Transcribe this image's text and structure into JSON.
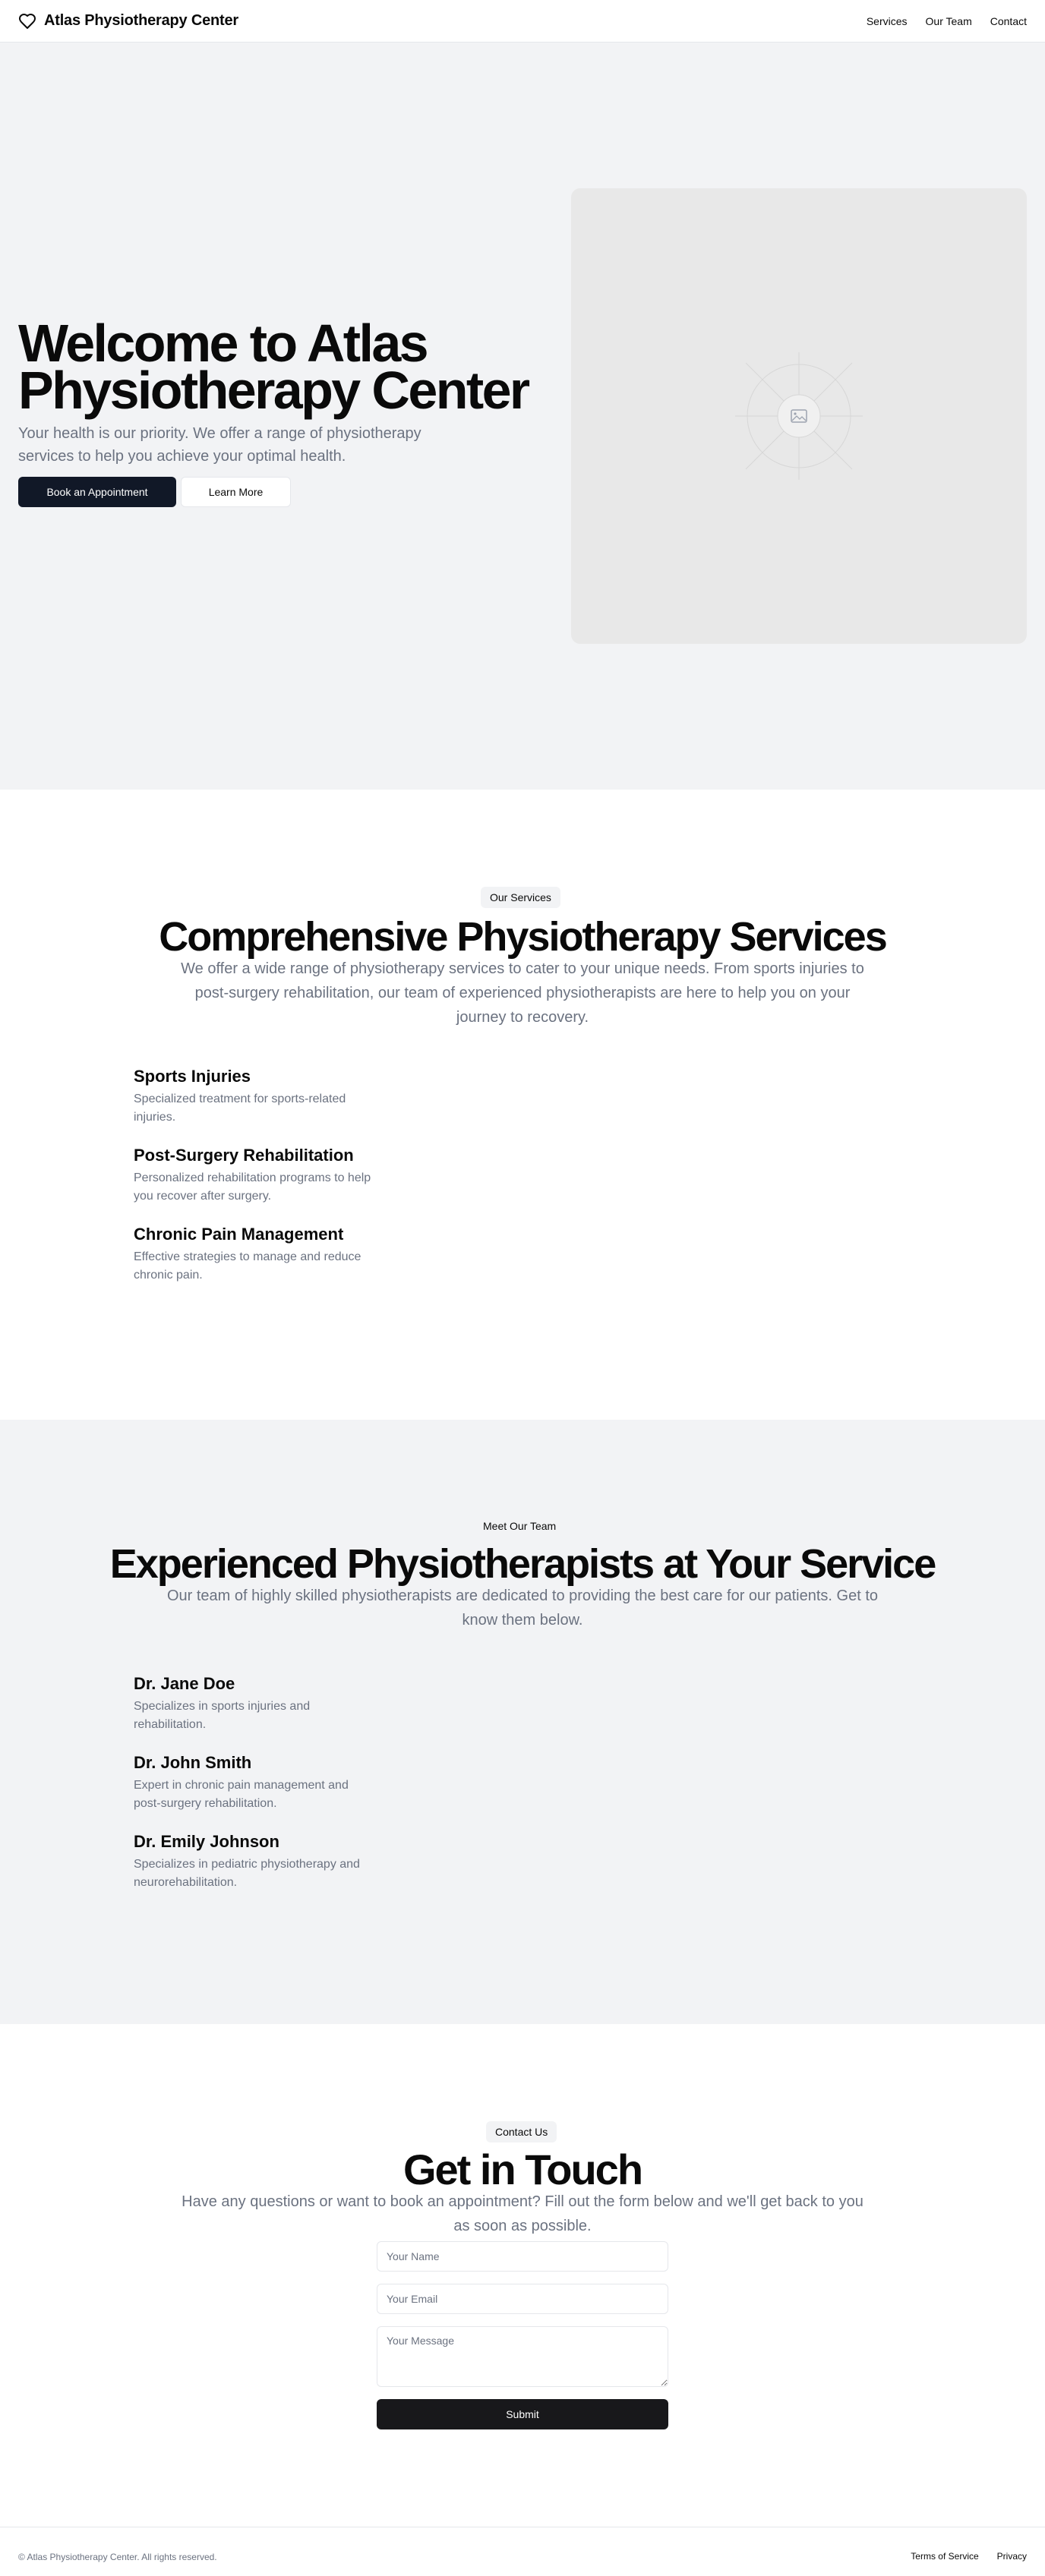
{
  "header": {
    "brand_name": "Atlas Physiotherapy Center",
    "logo_icon": "heart-icon",
    "nav": [
      {
        "label": "Services"
      },
      {
        "label": "Our Team"
      },
      {
        "label": "Contact"
      }
    ]
  },
  "hero": {
    "title_line1": "Welcome to Atlas",
    "title_line2": "Physiotherapy Center",
    "text": "Your health is our priority. We offer a range of physiotherapy services to help you achieve your optimal health.",
    "primary_button": "Book an Appointment",
    "secondary_button": "Learn More",
    "image_icon": "image-placeholder-icon"
  },
  "services": {
    "badge": "Our Services",
    "title": "Comprehensive Physiotherapy Services",
    "text": "We offer a wide range of physiotherapy services to cater to your unique needs. From sports injuries to post-surgery rehabilitation, our team of experienced physiotherapists are here to help you on your journey to recovery.",
    "items": [
      {
        "title": "Sports Injuries",
        "text": "Specialized treatment for sports-related injuries."
      },
      {
        "title": "Post-Surgery Rehabilitation",
        "text": "Personalized rehabilitation programs to help you recover after surgery."
      },
      {
        "title": "Chronic Pain Management",
        "text": "Effective strategies to manage and reduce chronic pain."
      }
    ]
  },
  "team": {
    "badge": "Meet Our Team",
    "title": "Experienced Physiotherapists at Your Service",
    "text": "Our team of highly skilled physiotherapists are dedicated to providing the best care for our patients. Get to know them below.",
    "members": [
      {
        "name": "Dr. Jane Doe",
        "text": "Specializes in sports injuries and rehabilitation."
      },
      {
        "name": "Dr. John Smith",
        "text": "Expert in chronic pain management and post-surgery rehabilitation."
      },
      {
        "name": "Dr. Emily Johnson",
        "text": "Specializes in pediatric physiotherapy and neurorehabilitation."
      }
    ]
  },
  "contact": {
    "badge": "Contact Us",
    "title": "Get in Touch",
    "text": "Have any questions or want to book an appointment? Fill out the form below and we'll get back to you as soon as possible.",
    "name_placeholder": "Your Name",
    "email_placeholder": "Your Email",
    "message_placeholder": "Your Message",
    "submit": "Submit"
  },
  "footer": {
    "copyright": "© Atlas Physiotherapy Center. All rights reserved.",
    "links": [
      {
        "label": "Terms of Service"
      },
      {
        "label": "Privacy"
      }
    ]
  }
}
